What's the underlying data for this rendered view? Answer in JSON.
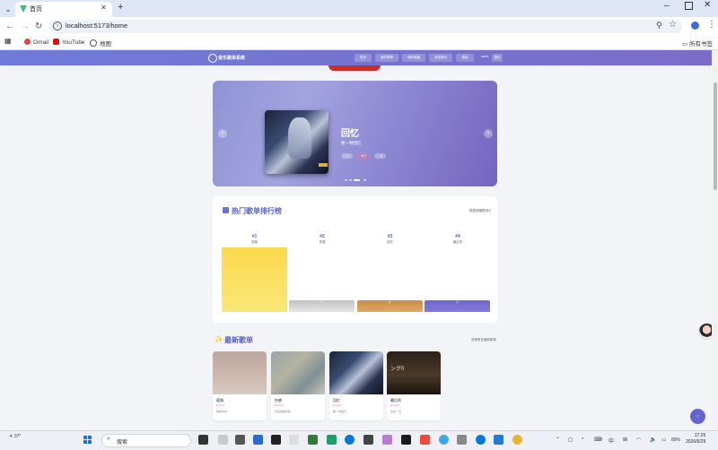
{
  "browser": {
    "tab_title": "首页",
    "url": "localhost:5173/home",
    "bookmarks": [
      {
        "label": "Gmail",
        "color": "#ea4335"
      },
      {
        "label": "YouTube",
        "color": "#ff0000"
      },
      {
        "label": "地图",
        "color": "#555555"
      }
    ],
    "all_bookmarks": "所有书签"
  },
  "app": {
    "title": "音乐歌单系统",
    "nav": [
      "首页",
      "我的歌单",
      "我的收藏",
      "发现音乐",
      "退出"
    ],
    "user": "user1",
    "user_button": "退出",
    "accent": "#6b72d6"
  },
  "carousel": {
    "title": "回忆",
    "subtitle": "那一种回忆",
    "chips": [
      "1",
      "0",
      "0"
    ],
    "slides": 4,
    "active_slide": 3
  },
  "ranking": {
    "title": "热门歌单排行榜",
    "hint": "根据收藏数统计",
    "items": [
      {
        "rank": "#1",
        "name": "孤独",
        "value": 100,
        "color_from": "#fcd94a",
        "color_to": "#f9e77a",
        "label": ""
      },
      {
        "rank": "#2",
        "name": "伤感",
        "value": 18,
        "color_from": "#c2c2c2",
        "color_to": "#e6e6e6",
        "label": "0"
      },
      {
        "rank": "#3",
        "name": "回忆",
        "value": 18,
        "color_from": "#c98d45",
        "color_to": "#e0aa6a",
        "label": "0"
      },
      {
        "rank": "#4",
        "name": "最后的",
        "value": 18,
        "color_from": "#6e66cf",
        "color_to": "#8578d6",
        "label": "0"
      }
    ]
  },
  "newest": {
    "title": "最新歌单",
    "more": "查看更多最新歌单",
    "cards": [
      {
        "name": "孤独",
        "meta": "● 0  ● 1",
        "artist": "孤独青年",
        "bg": "linear-gradient(180deg,#b9a9a0,#cbb6aa 50%,#d8cbc1)"
      },
      {
        "name": "伤感",
        "meta": "● 0  ● 0",
        "artist": "伤感歌曲合集",
        "bg": "linear-gradient(135deg,#9aa4a8,#b5b4a3 40%,#7f8f96 70%,#c9c6b8)"
      },
      {
        "name": "回忆",
        "meta": "● 0  ● 1",
        "artist": "那一种回忆",
        "bg": "linear-gradient(135deg,#1c2336,#3a4c74 35%,#b8c3d8 55%,#2a3352 75%,#0f1422)"
      },
      {
        "name": "最后的",
        "meta": "● 0  ● 0",
        "artist": "最后一天",
        "bg": "linear-gradient(180deg,#2b2116,#4a3a28 55%,#1a140d)",
        "overlay": "ング0"
      }
    ]
  },
  "taskbar": {
    "weather": "37°",
    "search": "搜索",
    "ime": "中",
    "battery": "80%",
    "time": "17:25",
    "date": "2026/6/29"
  }
}
